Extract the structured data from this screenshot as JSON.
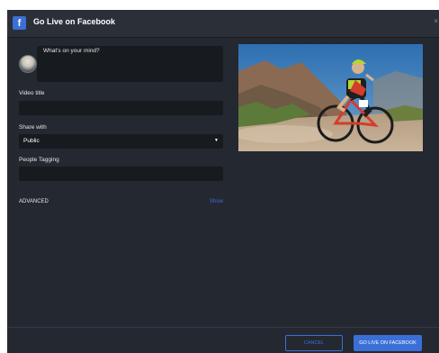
{
  "dialog": {
    "title": "Go Live on Facebook",
    "logo_glyph": "f",
    "close_glyph": "×"
  },
  "composer": {
    "placeholder": "What's on your mind?"
  },
  "video_title": {
    "label": "Video title",
    "value": ""
  },
  "share_with": {
    "label": "Share with",
    "selected": "Public"
  },
  "people_tagging": {
    "label": "People Tagging",
    "value": ""
  },
  "advanced": {
    "label": "ADVANCED",
    "toggle_label": "Show"
  },
  "footer": {
    "cancel_label": "CANCEL",
    "go_live_label": "GO LIVE ON FACEBOOK"
  },
  "colors": {
    "background": "#242830",
    "field": "#171a1f",
    "accent": "#3b6fd8"
  },
  "icons": {
    "logo": "facebook-logo-icon",
    "close": "close-icon",
    "dropdown": "chevron-down-icon"
  }
}
